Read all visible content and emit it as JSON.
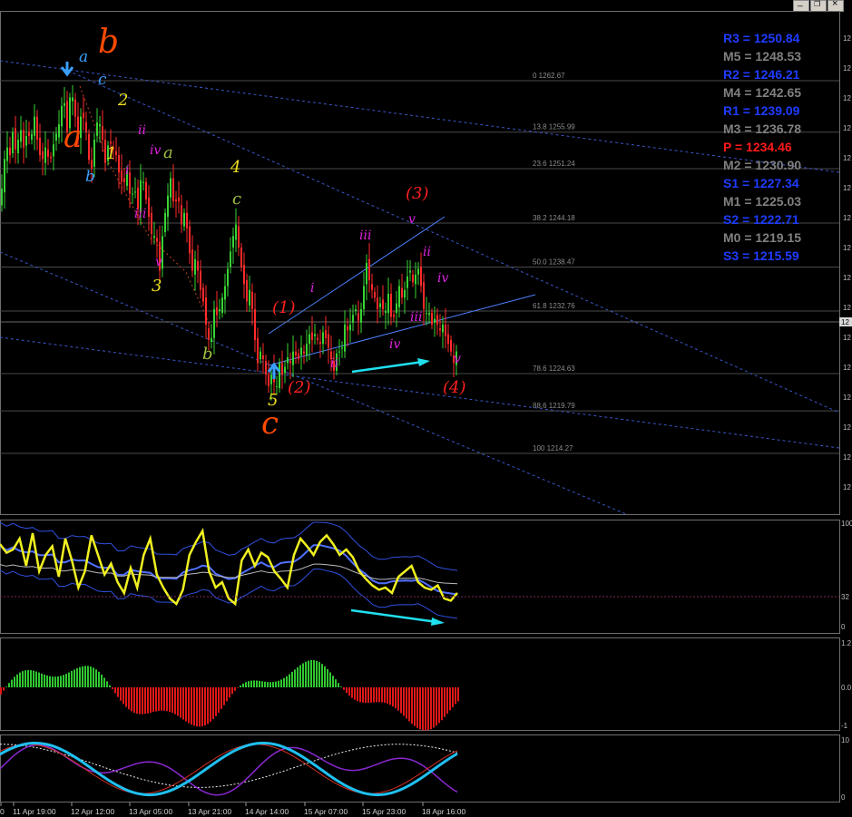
{
  "window": {
    "buttons": [
      {
        "name": "minimize-button",
        "glyph": "_"
      },
      {
        "name": "restore-button",
        "glyph": "❐"
      },
      {
        "name": "close-button",
        "glyph": "×"
      }
    ]
  },
  "price_axis": {
    "labels": [
      "12",
      "12",
      "12",
      "12",
      "12",
      "12",
      "12",
      "12",
      "12",
      "12",
      "12",
      "12",
      "12",
      "12",
      "12",
      "12"
    ],
    "current_price_label": "12"
  },
  "pivots": [
    {
      "label": "R3 = 1250.84",
      "color": "#1f3cff"
    },
    {
      "label": "M5 = 1248.53",
      "color": "#808080"
    },
    {
      "label": "R2 = 1246.21",
      "color": "#1f3cff"
    },
    {
      "label": "M4 = 1242.65",
      "color": "#808080"
    },
    {
      "label": "R1 = 1239.09",
      "color": "#1f3cff"
    },
    {
      "label": "M3 = 1236.78",
      "color": "#808080"
    },
    {
      "label": "P   = 1234.46",
      "color": "#ff1a1a"
    },
    {
      "label": "M2 = 1230.90",
      "color": "#808080"
    },
    {
      "label": "S1 = 1227.34",
      "color": "#1f3cff"
    },
    {
      "label": "M1 = 1225.03",
      "color": "#808080"
    },
    {
      "label": "S2 = 1222.71",
      "color": "#1f3cff"
    },
    {
      "label": "M0 = 1219.15",
      "color": "#808080"
    },
    {
      "label": "S3 = 1215.59",
      "color": "#1f3cff"
    }
  ],
  "fib_levels": [
    {
      "label": "0 1262.67",
      "price": 1262.67
    },
    {
      "label": "13.8 1255.99",
      "price": 1255.99
    },
    {
      "label": "23.6 1251.24",
      "price": 1251.24
    },
    {
      "label": "38.2 1244.18",
      "price": 1244.18
    },
    {
      "label": "50.0 1238.47",
      "price": 1238.47
    },
    {
      "label": "61.8 1232.76",
      "price": 1232.76
    },
    {
      "label": "78.6 1224.63",
      "price": 1224.63
    },
    {
      "label": "88.6 1219.79",
      "price": 1219.79
    },
    {
      "label": "100 1214.27",
      "price": 1214.27
    }
  ],
  "wave_labels": [
    {
      "text": "b",
      "color": "#ff4a00",
      "size": 36
    },
    {
      "text": "a",
      "color": "#ff4a00",
      "size": 34
    },
    {
      "text": "c",
      "color": "#ff4a00",
      "size": 34
    },
    {
      "text": "a",
      "color": "#3aa0ff",
      "size": 17
    },
    {
      "text": "c",
      "color": "#3aa0ff",
      "size": 17
    },
    {
      "text": "b",
      "color": "#3aa0ff",
      "size": 17
    },
    {
      "text": "2",
      "color": "#f0e020",
      "size": 18
    },
    {
      "text": "1",
      "color": "#f0e020",
      "size": 18
    },
    {
      "text": "3",
      "color": "#f0e020",
      "size": 18
    },
    {
      "text": "4",
      "color": "#f0e020",
      "size": 18
    },
    {
      "text": "5",
      "color": "#f0e020",
      "size": 18
    },
    {
      "text": "a",
      "color": "#a0c040",
      "size": 18
    },
    {
      "text": "c",
      "color": "#a0c040",
      "size": 18
    },
    {
      "text": "b",
      "color": "#a0c040",
      "size": 18
    },
    {
      "text": "ii",
      "color": "#e020e0",
      "size": 14
    },
    {
      "text": "i",
      "color": "#e020e0",
      "size": 14
    },
    {
      "text": "iv",
      "color": "#e020e0",
      "size": 14
    },
    {
      "text": "iii",
      "color": "#e020e0",
      "size": 14
    },
    {
      "text": "v",
      "color": "#e020e0",
      "size": 14
    },
    {
      "text": "(1)",
      "color": "#ff2020",
      "size": 18
    },
    {
      "text": "(2)",
      "color": "#ff2020",
      "size": 18
    },
    {
      "text": "(3)",
      "color": "#ff2020",
      "size": 18
    },
    {
      "text": "(4)",
      "color": "#ff2020",
      "size": 18
    },
    {
      "text": "i",
      "color": "#e020e0",
      "size": 14
    },
    {
      "text": "ii",
      "color": "#e020e0",
      "size": 14
    },
    {
      "text": "iii",
      "color": "#e020e0",
      "size": 14
    },
    {
      "text": "iv",
      "color": "#e020e0",
      "size": 14
    },
    {
      "text": "v",
      "color": "#e020e0",
      "size": 14
    },
    {
      "text": "ii",
      "color": "#e020e0",
      "size": 14
    },
    {
      "text": "iii",
      "color": "#e020e0",
      "size": 14
    },
    {
      "text": "iv",
      "color": "#e020e0",
      "size": 14
    },
    {
      "text": "v",
      "color": "#e020e0",
      "size": 14
    }
  ],
  "oscillator1": {
    "axis_labels": [
      "100",
      "32",
      "0"
    ]
  },
  "oscillator2": {
    "axis_labels": [
      "1.2",
      "0.0",
      "-1"
    ]
  },
  "oscillator3": {
    "axis_labels": [
      "10",
      "0"
    ]
  },
  "time_axis": {
    "labels": [
      "0",
      "11 Apr 19:00",
      "12 Apr 12:00",
      "13 Apr 05:00",
      "13 Apr 21:00",
      "14 Apr 14:00",
      "15 Apr 07:00",
      "15 Apr 23:00",
      "18 Apr 16:00"
    ]
  },
  "chart_data": [
    {
      "type": "candlestick",
      "title": "",
      "ylim": [
        1206.5,
        1271.5
      ],
      "close_path": [
        [
          0,
          1246
        ],
        [
          3,
          1250
        ],
        [
          7,
          1255
        ],
        [
          10,
          1252
        ],
        [
          14,
          1256
        ],
        [
          18,
          1253
        ],
        [
          22,
          1257
        ],
        [
          26,
          1254
        ],
        [
          30,
          1256
        ],
        [
          34,
          1255
        ],
        [
          38,
          1258
        ],
        [
          42,
          1254
        ],
        [
          46,
          1252
        ],
        [
          50,
          1254
        ],
        [
          55,
          1252
        ],
        [
          60,
          1255
        ],
        [
          65,
          1257
        ],
        [
          70,
          1261
        ],
        [
          74,
          1256
        ],
        [
          78,
          1262
        ],
        [
          82,
          1259
        ],
        [
          86,
          1255
        ],
        [
          90,
          1259
        ],
        [
          95,
          1256
        ],
        [
          100,
          1250
        ],
        [
          104,
          1255
        ],
        [
          108,
          1258
        ],
        [
          112,
          1256
        ],
        [
          116,
          1252
        ],
        [
          120,
          1255
        ],
        [
          124,
          1254
        ],
        [
          128,
          1253
        ],
        [
          132,
          1250
        ],
        [
          136,
          1249
        ],
        [
          140,
          1251
        ],
        [
          144,
          1247
        ],
        [
          148,
          1249
        ],
        [
          152,
          1246
        ],
        [
          156,
          1251
        ],
        [
          160,
          1248
        ],
        [
          164,
          1245
        ],
        [
          168,
          1242
        ],
        [
          172,
          1243
        ],
        [
          176,
          1238
        ],
        [
          180,
          1244
        ],
        [
          184,
          1247
        ],
        [
          188,
          1250
        ],
        [
          192,
          1246
        ],
        [
          196,
          1248
        ],
        [
          200,
          1244
        ],
        [
          204,
          1246
        ],
        [
          208,
          1241
        ],
        [
          212,
          1238
        ],
        [
          216,
          1240
        ],
        [
          220,
          1236
        ],
        [
          224,
          1234
        ],
        [
          228,
          1230
        ],
        [
          232,
          1228
        ],
        [
          236,
          1233
        ],
        [
          240,
          1232
        ],
        [
          244,
          1234
        ],
        [
          248,
          1236
        ],
        [
          252,
          1239
        ],
        [
          256,
          1242
        ],
        [
          260,
          1244
        ],
        [
          264,
          1240
        ],
        [
          268,
          1237
        ],
        [
          272,
          1234
        ],
        [
          276,
          1236
        ],
        [
          280,
          1230
        ],
        [
          284,
          1226
        ],
        [
          288,
          1228
        ],
        [
          292,
          1225
        ],
        [
          296,
          1223
        ],
        [
          300,
          1225
        ],
        [
          304,
          1222
        ],
        [
          308,
          1226
        ],
        [
          312,
          1224
        ],
        [
          316,
          1227
        ],
        [
          320,
          1226
        ],
        [
          324,
          1228
        ],
        [
          328,
          1226
        ],
        [
          332,
          1228
        ],
        [
          336,
          1227
        ],
        [
          340,
          1230
        ],
        [
          344,
          1229
        ],
        [
          348,
          1230
        ],
        [
          352,
          1228
        ],
        [
          356,
          1230
        ],
        [
          360,
          1229
        ],
        [
          364,
          1227
        ],
        [
          368,
          1225
        ],
        [
          372,
          1228
        ],
        [
          376,
          1227
        ],
        [
          380,
          1231
        ],
        [
          384,
          1230
        ],
        [
          388,
          1232
        ],
        [
          392,
          1233
        ],
        [
          396,
          1231
        ],
        [
          400,
          1235
        ],
        [
          404,
          1239
        ],
        [
          408,
          1236
        ],
        [
          412,
          1235
        ],
        [
          416,
          1233
        ],
        [
          420,
          1234
        ],
        [
          424,
          1232
        ],
        [
          428,
          1235
        ],
        [
          432,
          1231
        ],
        [
          436,
          1233
        ],
        [
          440,
          1236
        ],
        [
          444,
          1234
        ],
        [
          448,
          1237
        ],
        [
          452,
          1238
        ],
        [
          456,
          1236
        ],
        [
          460,
          1239
        ],
        [
          464,
          1236
        ],
        [
          468,
          1232
        ],
        [
          472,
          1233
        ],
        [
          476,
          1231
        ],
        [
          480,
          1232
        ],
        [
          484,
          1230
        ],
        [
          488,
          1231
        ],
        [
          492,
          1229
        ],
        [
          496,
          1228
        ],
        [
          500,
          1226
        ],
        [
          504,
          1228
        ]
      ]
    },
    {
      "type": "line",
      "title": "",
      "ylim": [
        0,
        100
      ],
      "series": [
        {
          "values": [
            80,
            72,
            75,
            85,
            60,
            90,
            55,
            70,
            78,
            50,
            85,
            65,
            40,
            55,
            88,
            70,
            52,
            62,
            45,
            35,
            58,
            40,
            70,
            85,
            52,
            40,
            30,
            25,
            38,
            70,
            82,
            92,
            55,
            40,
            45,
            30,
            25,
            65,
            75,
            60,
            72,
            68,
            55,
            48,
            40,
            70,
            85,
            78,
            70,
            82,
            88,
            80,
            70,
            75,
            68,
            55,
            48,
            42,
            38,
            40,
            35,
            50,
            55,
            60,
            45,
            40,
            38,
            42,
            30,
            28,
            35
          ]
        }
      ]
    }
  ]
}
